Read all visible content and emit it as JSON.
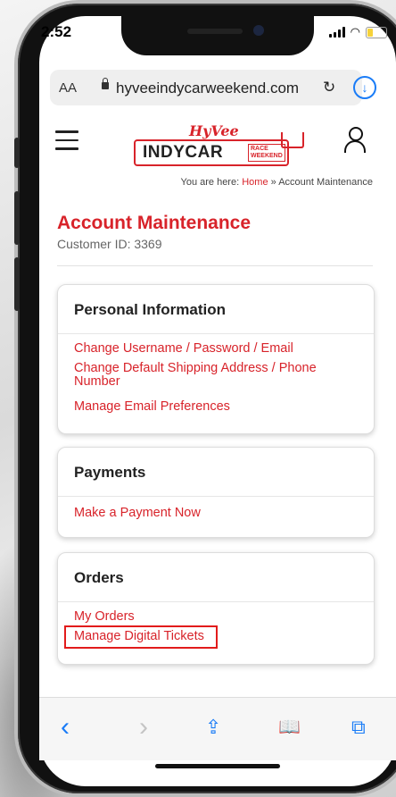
{
  "status": {
    "time": "2:52"
  },
  "browser": {
    "aa_label": "AA",
    "url": "hyveeindycarweekend.com",
    "reload_glyph": "↻",
    "download_glyph": "↓"
  },
  "header": {
    "logo_top": "HyVee",
    "logo_main": "INDYCAR",
    "logo_sub": "RACE WEEKEND"
  },
  "breadcrumb": {
    "prefix": "You are here:",
    "home": "Home",
    "separator": "»",
    "current": "Account Maintenance"
  },
  "page": {
    "title": "Account Maintenance",
    "customer_id": "Customer ID: 3369"
  },
  "cards": [
    {
      "title": "Personal Information",
      "links": [
        "Change Username / Password / Email",
        "Change Default Shipping Address / Phone",
        "Number",
        "Manage Email Preferences"
      ]
    },
    {
      "title": "Payments",
      "links": [
        "Make a Payment Now"
      ]
    },
    {
      "title": "Orders",
      "links": [
        "My Orders",
        "Manage Digital Tickets"
      ]
    }
  ],
  "toolbar": {
    "back": "‹",
    "forward": "›",
    "share": "⇪",
    "bookmarks": "📖",
    "tabs": "⧉"
  },
  "colors": {
    "accent": "#d8232a",
    "link_blue": "#1a7cf7"
  }
}
